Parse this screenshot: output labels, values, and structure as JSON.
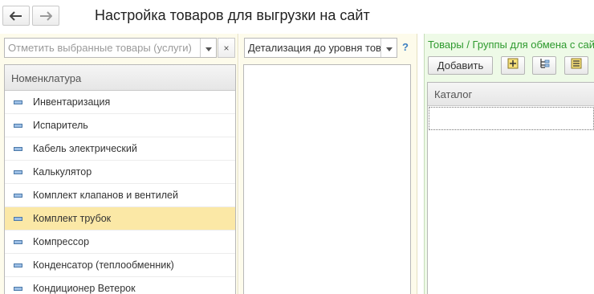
{
  "header": {
    "back_icon": "arrow-left-icon",
    "forward_icon": "arrow-right-icon",
    "title": "Настройка товаров для выгрузки на сайт"
  },
  "filter": {
    "placeholder": "Отметить выбранные товары (услуги)",
    "dropdown_icon": "chevron-down-icon",
    "clear_label": "×"
  },
  "nomenclature": {
    "column_header": "Номенклатура",
    "items": [
      {
        "label": "Инвентаризация"
      },
      {
        "label": "Испаритель"
      },
      {
        "label": "Кабель электрический"
      },
      {
        "label": "Калькулятор"
      },
      {
        "label": "Комплект клапанов и вентилей"
      },
      {
        "label": "Комплект трубок",
        "selected": true
      },
      {
        "label": "Компрессор"
      },
      {
        "label": "Конденсатор (теплообменник)"
      },
      {
        "label": "Кондиционер Ветерок"
      }
    ]
  },
  "detail": {
    "value": "Детализация до уровня тов",
    "dropdown_icon": "chevron-down-icon",
    "help_label": "?"
  },
  "exchange": {
    "title": "Товары / Группы для обмена с сай",
    "add_label": "Добавить",
    "tool_icons": [
      "add-group-icon",
      "hierarchy-icon",
      "list-filter-icon"
    ],
    "column_header": "Каталог"
  },
  "colors": {
    "left_bg": "#fdfbeb",
    "right_bg": "#eefae7",
    "selected_row": "#fbe8a6",
    "exchange_title": "#2e9a2e",
    "help": "#3d7fc1"
  }
}
